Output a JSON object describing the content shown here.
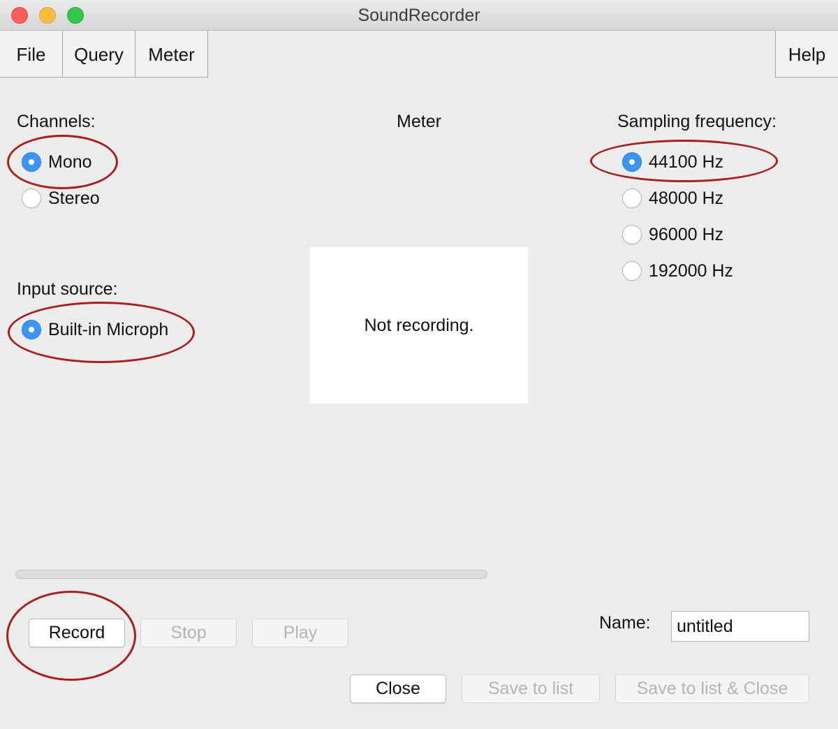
{
  "window": {
    "title": "SoundRecorder"
  },
  "menubar": {
    "items": [
      {
        "label": "File"
      },
      {
        "label": "Query"
      },
      {
        "label": "Meter"
      },
      {
        "label": "Help"
      }
    ]
  },
  "channels": {
    "label": "Channels:",
    "options": [
      {
        "label": "Mono",
        "checked": true
      },
      {
        "label": "Stereo",
        "checked": false
      }
    ]
  },
  "input_source": {
    "label": "Input source:",
    "options": [
      {
        "label": "Built-in Microph",
        "checked": true
      }
    ]
  },
  "meter": {
    "label": "Meter",
    "status": "Not recording."
  },
  "sampling": {
    "label": "Sampling frequency:",
    "options": [
      {
        "label": "44100 Hz",
        "checked": true
      },
      {
        "label": "48000 Hz",
        "checked": false
      },
      {
        "label": "96000 Hz",
        "checked": false
      },
      {
        "label": "192000 Hz",
        "checked": false
      }
    ]
  },
  "progress": {
    "value": 0
  },
  "transport": {
    "record_label": "Record",
    "stop_label": "Stop",
    "play_label": "Play"
  },
  "name_field": {
    "label": "Name:",
    "value": "untitled"
  },
  "footer": {
    "close_label": "Close",
    "save_label": "Save to list",
    "save_close_label": "Save to list & Close"
  },
  "colors": {
    "accent": "#3a95f7",
    "annotation": "#a91e1e"
  }
}
